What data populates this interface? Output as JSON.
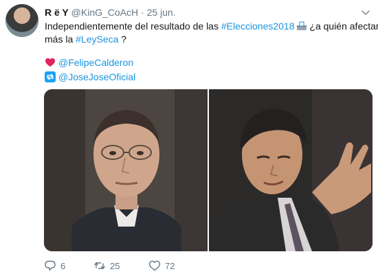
{
  "tweet": {
    "display_name": "R ë Y",
    "handle": "@KinG_CoAcH",
    "separator": "·",
    "date": "25 jun.",
    "text_part1": "Independientemente del resultado de las ",
    "hashtag1": "#Elecciones2018",
    "text_part2": " ¿a quién afectará",
    "text_part3": "más la ",
    "hashtag2": "#LeySeca",
    "text_part4": " ?",
    "like_mention": "@FelipeCalderon",
    "retweet_mention": "@JoseJoseOficial"
  },
  "actions": {
    "reply_count": "6",
    "retweet_count": "25",
    "like_count": "72"
  },
  "colors": {
    "link": "#1b95e0",
    "muted": "#657786",
    "heart": "#e0245e",
    "retweet_icon": "#1da1f2"
  },
  "icons": {
    "caret": "chevron-down-icon",
    "ballot": "ballot-box-icon",
    "like": "heart-icon",
    "retweet": "retweet-icon",
    "reply": "reply-icon"
  }
}
